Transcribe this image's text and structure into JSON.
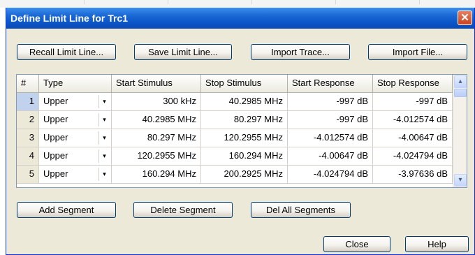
{
  "dialog": {
    "title": "Define Limit Line for Trc1",
    "close_glyph": "✕"
  },
  "top_buttons": {
    "recall": "Recall Limit Line...",
    "save": "Save Limit Line...",
    "import_trace": "Import Trace...",
    "import_file": "Import File..."
  },
  "table": {
    "columns": [
      "#",
      "Type",
      "Start Stimulus",
      "Stop Stimulus",
      "Start Response",
      "Stop Response"
    ],
    "dropdown_glyph": "▾",
    "scroll_up_glyph": "▴",
    "scroll_down_glyph": "▾",
    "rows": [
      {
        "num": "1",
        "type": "Upper",
        "start_stim": "300 kHz",
        "stop_stim": "40.2985 MHz",
        "start_resp": "-997 dB",
        "stop_resp": "-997 dB"
      },
      {
        "num": "2",
        "type": "Upper",
        "start_stim": "40.2985 MHz",
        "stop_stim": "80.297 MHz",
        "start_resp": "-997 dB",
        "stop_resp": "-4.012574 dB"
      },
      {
        "num": "3",
        "type": "Upper",
        "start_stim": "80.297 MHz",
        "stop_stim": "120.2955 MHz",
        "start_resp": "-4.012574 dB",
        "stop_resp": "-4.00647 dB"
      },
      {
        "num": "4",
        "type": "Upper",
        "start_stim": "120.2955 MHz",
        "stop_stim": "160.294 MHz",
        "start_resp": "-4.00647 dB",
        "stop_resp": "-4.024794 dB"
      },
      {
        "num": "5",
        "type": "Upper",
        "start_stim": "160.294 MHz",
        "stop_stim": "200.2925 MHz",
        "start_resp": "-4.024794 dB",
        "stop_resp": "-3.97636 dB"
      }
    ]
  },
  "segment_buttons": {
    "add": "Add Segment",
    "delete": "Delete Segment",
    "del_all": "Del All Segments"
  },
  "footer_buttons": {
    "close": "Close",
    "help": "Help"
  },
  "colors": {
    "titlebar": "#0a53c7",
    "close_button": "#d9542f",
    "dialog_bg": "#ece9d8",
    "selected_row_number": "#c1d2ee"
  }
}
